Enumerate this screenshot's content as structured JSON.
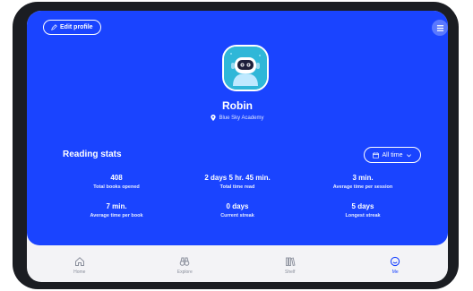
{
  "header": {
    "edit_profile_label": "Edit profile"
  },
  "profile": {
    "name": "Robin",
    "school": "Blue Sky Academy"
  },
  "stats": {
    "title": "Reading stats",
    "filter_label": "All time",
    "items": [
      {
        "value": "408",
        "label": "Total books opened"
      },
      {
        "value": "2 days 5 hr. 45 min.",
        "label": "Total time read"
      },
      {
        "value": "3 min.",
        "label": "Average time per session"
      },
      {
        "value": "7 min.",
        "label": "Average time per book"
      },
      {
        "value": "0 days",
        "label": "Current streak"
      },
      {
        "value": "5 days",
        "label": "Longest streak"
      }
    ]
  },
  "nav": {
    "items": [
      {
        "label": "Home",
        "icon": "home-icon"
      },
      {
        "label": "Explore",
        "icon": "binoculars-icon"
      },
      {
        "label": "Shelf",
        "icon": "books-icon"
      },
      {
        "label": "Me",
        "icon": "smiley-icon"
      }
    ],
    "active": "Me"
  },
  "colors": {
    "brand_blue": "#1a44ff",
    "avatar_teal": "#2fb7d8",
    "nav_background": "#f3f3f6"
  }
}
